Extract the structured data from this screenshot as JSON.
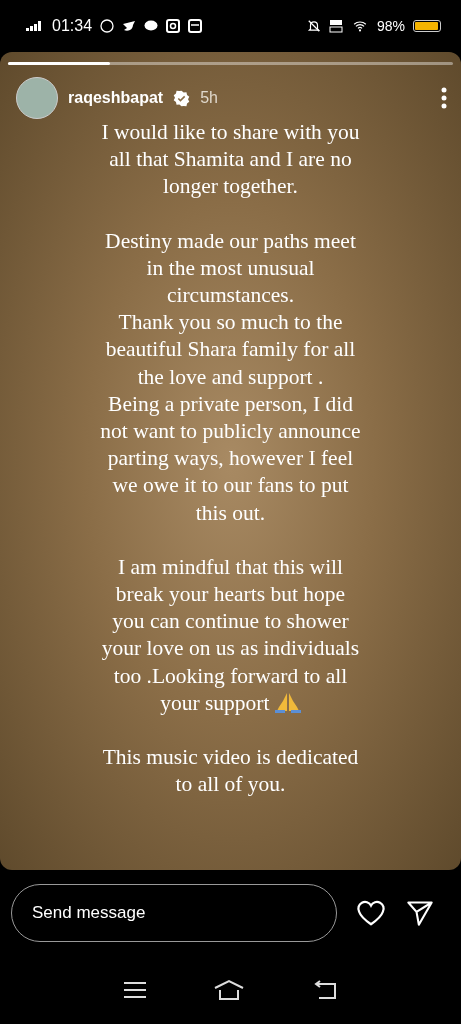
{
  "status_bar": {
    "time": "01:34",
    "battery": "98%"
  },
  "story": {
    "progress": {
      "level": 0.23
    },
    "author": {
      "username": "raqeshbapat",
      "verified": true,
      "time": "5h"
    },
    "paragraphs": [
      {
        "text": "I would like to share with you\nall that Shamita and I are no\nlonger together.",
        "gap_before": false,
        "emoji": false
      },
      {
        "text": "Destiny made our paths meet\nin the most unusual\ncircumstances.",
        "gap_before": true,
        "emoji": false
      },
      {
        "text": "Thank you so much to the\nbeautiful Shara family for all\nthe love and support .",
        "gap_before": false,
        "emoji": false
      },
      {
        "text": "Being a private person, I did\nnot want to publicly announce\nparting ways, however I feel\nwe owe it to our fans to put\nthis out.",
        "gap_before": false,
        "emoji": false
      },
      {
        "text": "I am mindful that this will\nbreak your hearts but hope\nyou can continue to shower\nyour love on us as individuals\ntoo .Looking forward to all\nyour support",
        "gap_before": true,
        "emoji": true
      },
      {
        "text": "This music video is dedicated\nto all of you.",
        "gap_before": true,
        "emoji": false
      }
    ]
  },
  "reply": {
    "placeholder": "Send message"
  }
}
